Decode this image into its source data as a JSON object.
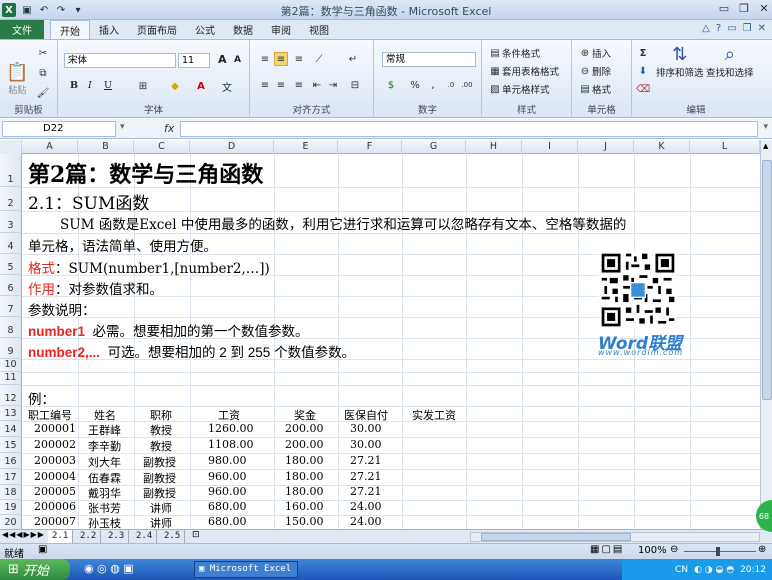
{
  "titlebar": {
    "title": "第2篇：数学与三角函数 - Microsoft Excel",
    "logo": "X"
  },
  "ribbon_tabs": {
    "file": "文件",
    "tabs": [
      "开始",
      "插入",
      "页面布局",
      "公式",
      "数据",
      "审阅",
      "视图"
    ]
  },
  "ribbon": {
    "clipboard": {
      "paste": "粘贴",
      "label": "剪贴板"
    },
    "font": {
      "name": "宋体",
      "size": "11",
      "bold": "B",
      "italic": "I",
      "underline": "U",
      "grow": "A",
      "shrink": "A",
      "label": "字体"
    },
    "align": {
      "label": "对齐方式"
    },
    "number": {
      "format": "常规",
      "label": "数字"
    },
    "styles": {
      "cond": "条件格式",
      "table": "套用表格格式",
      "cell": "单元格样式",
      "label": "样式"
    },
    "cells": {
      "insert": "插入",
      "delete": "删除",
      "format": "格式",
      "label": "单元格"
    },
    "edit": {
      "sort": "排序和筛选",
      "find": "查找和选择",
      "label": "编辑"
    }
  },
  "formula_bar": {
    "name_box": "D22",
    "fx": "fx",
    "value": ""
  },
  "columns": [
    "A",
    "B",
    "C",
    "D",
    "E",
    "F",
    "G",
    "H",
    "I",
    "J",
    "K",
    "L"
  ],
  "rows": [
    "1",
    "2",
    "3",
    "4",
    "5",
    "6",
    "7",
    "8",
    "9",
    "10",
    "11",
    "12",
    "13",
    "14",
    "15",
    "16",
    "17",
    "18",
    "19",
    "20"
  ],
  "content": {
    "r1": "第2篇：数学与三角函数",
    "r2": "2.1：SUM函数",
    "r3": "SUM 函数是Excel 中使用最多的函数，利用它进行求和运算可以忽略存有文本、空格等数据的",
    "r4": "单元格，语法简单、使用方便。",
    "r5_label": "格式",
    "r5_text": "：SUM(number1,[number2,…])",
    "r6_label": "作用",
    "r6_text": "：对参数值求和。",
    "r7": "参数说明：",
    "r8_label": "number1",
    "r8_text": "必需。想要相加的第一个数值参数。",
    "r9_label": "number2,...",
    "r9_text": "可选。想要相加的 2 到 255 个数值参数。",
    "r12": "例："
  },
  "table": {
    "headers": [
      "职工编号",
      "姓名",
      "职称",
      "工资",
      "奖金",
      "医保自付",
      "实发工资"
    ],
    "rows": [
      [
        "200001",
        "王群峰",
        "教授",
        "1260.00",
        "200.00",
        "30.00",
        ""
      ],
      [
        "200002",
        "李辛勤",
        "教授",
        "1108.00",
        "200.00",
        "30.00",
        ""
      ],
      [
        "200003",
        "刘大年",
        "副教授",
        "980.00",
        "180.00",
        "27.21",
        ""
      ],
      [
        "200004",
        "伍春霖",
        "副教授",
        "960.00",
        "180.00",
        "27.21",
        ""
      ],
      [
        "200005",
        "戴羽华",
        "副教授",
        "960.00",
        "180.00",
        "27.21",
        ""
      ],
      [
        "200006",
        "张书芳",
        "讲师",
        "680.00",
        "160.00",
        "24.00",
        ""
      ],
      [
        "200007",
        "孙玉枝",
        "讲师",
        "680.00",
        "150.00",
        "24.00",
        ""
      ]
    ]
  },
  "watermark": {
    "word": "Word",
    "lm": "联盟",
    "url": "www.wordlm.com"
  },
  "sheet_tabs": [
    "2.1",
    "2.2",
    "2.3",
    "2.4",
    "2.5"
  ],
  "status": {
    "ready": "就绪",
    "zoom": "100%"
  },
  "taskbar": {
    "start": "开始",
    "task": "Microsoft Excel ...",
    "lang": "CN",
    "time": "20:12"
  },
  "badge": "68"
}
